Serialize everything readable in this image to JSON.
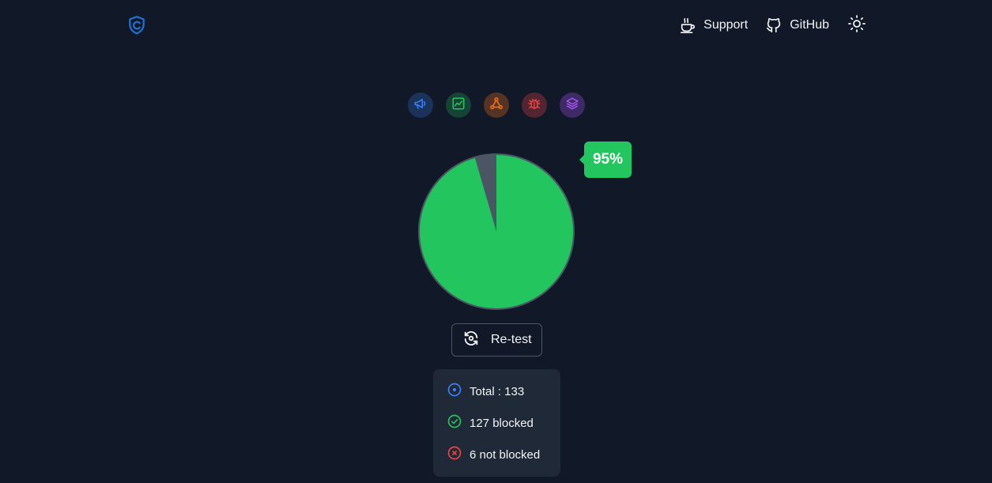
{
  "header": {
    "logo_icon": "shield-check-icon",
    "nav": [
      {
        "label": "Support",
        "icon": "coffee-icon"
      },
      {
        "label": "GitHub",
        "icon": "github-icon"
      }
    ],
    "theme_toggle_icon": "sun-icon"
  },
  "categories": [
    {
      "icon": "megaphone-icon",
      "color": "#3b82f6"
    },
    {
      "icon": "chart-icon",
      "color": "#22c55e"
    },
    {
      "icon": "network-icon",
      "color": "#f97316"
    },
    {
      "icon": "bug-icon",
      "color": "#ef4444"
    },
    {
      "icon": "layers-icon",
      "color": "#a855f7"
    }
  ],
  "score": {
    "percent_label": "95%",
    "blocked_fraction": 0.955,
    "blocked_color": "#22c55e",
    "not_blocked_color": "#ef4444"
  },
  "retest": {
    "label": "Re-test",
    "icon": "refresh-icon"
  },
  "summary": {
    "total": "Total : 133",
    "blocked": "127 blocked",
    "not_blocked": "6 not blocked"
  }
}
